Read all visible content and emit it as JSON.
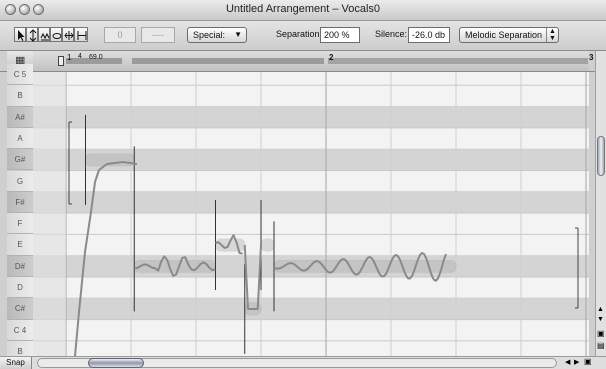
{
  "window": {
    "title": "Untitled Arrangement – Vocals0"
  },
  "toolbar": {
    "value_field": "0",
    "note_field": "----",
    "special_label": "Special:",
    "separation_label": "Separation:",
    "separation_value": "200 %",
    "silence_label": "Silence:",
    "silence_value": "-26.0 db",
    "separation_mode": "Melodic Separation"
  },
  "ruler": {
    "bar1": "1",
    "tempo": "4",
    "tempo_value": "69.0",
    "bar2": "2",
    "bar3": "3"
  },
  "keyboard": {
    "keys": [
      {
        "label": "C 5",
        "type": "white"
      },
      {
        "label": "B",
        "type": "white"
      },
      {
        "label": "A#",
        "type": "black"
      },
      {
        "label": "A",
        "type": "white"
      },
      {
        "label": "G#",
        "type": "black"
      },
      {
        "label": "G",
        "type": "white"
      },
      {
        "label": "F#",
        "type": "black"
      },
      {
        "label": "F",
        "type": "white"
      },
      {
        "label": "E",
        "type": "white"
      },
      {
        "label": "D#",
        "type": "black"
      },
      {
        "label": "D",
        "type": "white"
      },
      {
        "label": "C#",
        "type": "black"
      },
      {
        "label": "C 4",
        "type": "white"
      },
      {
        "label": "B",
        "type": "white"
      }
    ]
  },
  "notes": [
    {
      "pitch": "G#",
      "start_beat": 0.3,
      "end_beat": 1.05
    },
    {
      "pitch": "D#",
      "start_beat": 1.05,
      "end_beat": 2.3
    },
    {
      "pitch": "E",
      "start_beat": 2.3,
      "end_beat": 2.75
    },
    {
      "pitch": "C#",
      "start_beat": 2.75,
      "end_beat": 3.0
    },
    {
      "pitch": "E",
      "start_beat": 3.0,
      "end_beat": 3.2
    },
    {
      "pitch": "D#",
      "start_beat": 3.2,
      "end_beat": 6.0
    }
  ],
  "scroll": {
    "snap_label": "Snap"
  },
  "colors": {
    "grid_light": "#f3f3f3",
    "black_key_row": "#d4d4d4",
    "note_blob": "#a9a9a9",
    "pitch_curve": "#8a8a8a",
    "key_label": "#555555"
  }
}
